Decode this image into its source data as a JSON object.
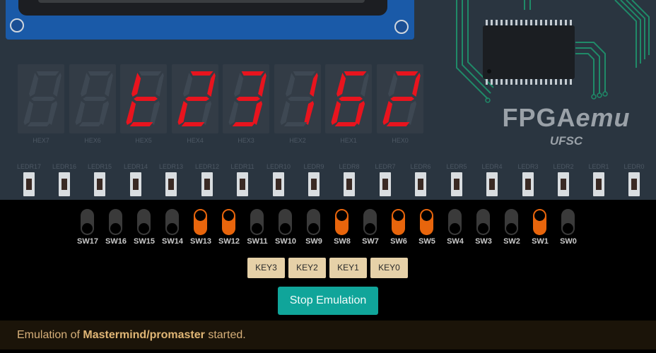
{
  "board": {
    "brand_title_prefix": "FPGA",
    "brand_title_suffix": "emu",
    "brand_subtitle": "UFSC",
    "hex_displays": [
      {
        "label": "HEX7",
        "lit": false,
        "on_segments": ""
      },
      {
        "label": "HEX6",
        "lit": false,
        "on_segments": ""
      },
      {
        "label": "HEX5",
        "lit": true,
        "on_segments": "defg",
        "char": "t"
      },
      {
        "label": "HEX4",
        "lit": true,
        "on_segments": "abdeg",
        "char": "2"
      },
      {
        "label": "HEX3",
        "lit": true,
        "on_segments": "abcdg",
        "char": "3"
      },
      {
        "label": "HEX2",
        "lit": true,
        "on_segments": "bc",
        "char": "1"
      },
      {
        "label": "HEX1",
        "lit": true,
        "on_segments": "acdefg",
        "char": "6"
      },
      {
        "label": "HEX0",
        "lit": true,
        "on_segments": "abdeg",
        "char": "2"
      }
    ],
    "leds": [
      "LEDR17",
      "LEDR16",
      "LEDR15",
      "LEDR14",
      "LEDR13",
      "LEDR12",
      "LEDR11",
      "LEDR10",
      "LEDR9",
      "LEDR8",
      "LEDR7",
      "LEDR6",
      "LEDR5",
      "LEDR4",
      "LEDR3",
      "LEDR2",
      "LEDR1",
      "LEDR0"
    ]
  },
  "switches": [
    {
      "label": "SW17",
      "on": false
    },
    {
      "label": "SW16",
      "on": false
    },
    {
      "label": "SW15",
      "on": false
    },
    {
      "label": "SW14",
      "on": false
    },
    {
      "label": "SW13",
      "on": true
    },
    {
      "label": "SW12",
      "on": true
    },
    {
      "label": "SW11",
      "on": false
    },
    {
      "label": "SW10",
      "on": false
    },
    {
      "label": "SW9",
      "on": false
    },
    {
      "label": "SW8",
      "on": true
    },
    {
      "label": "SW7",
      "on": false
    },
    {
      "label": "SW6",
      "on": true
    },
    {
      "label": "SW5",
      "on": true
    },
    {
      "label": "SW4",
      "on": false
    },
    {
      "label": "SW3",
      "on": false
    },
    {
      "label": "SW2",
      "on": false
    },
    {
      "label": "SW1",
      "on": true
    },
    {
      "label": "SW0",
      "on": false
    }
  ],
  "keys": [
    "KEY3",
    "KEY2",
    "KEY1",
    "KEY0"
  ],
  "stop_button_label": "Stop Emulation",
  "status": {
    "prefix": "Emulation of ",
    "project": "Mastermind/promaster",
    "suffix": " started."
  },
  "colors": {
    "segment_on": "#e8141e",
    "segment_off": "#3e4853",
    "switch_on": "#e8650c",
    "switch_off": "#3a3a3a",
    "key_bg": "#e6d1a8",
    "stop_button_bg": "#10a59a",
    "status_text": "#d7b07a"
  }
}
